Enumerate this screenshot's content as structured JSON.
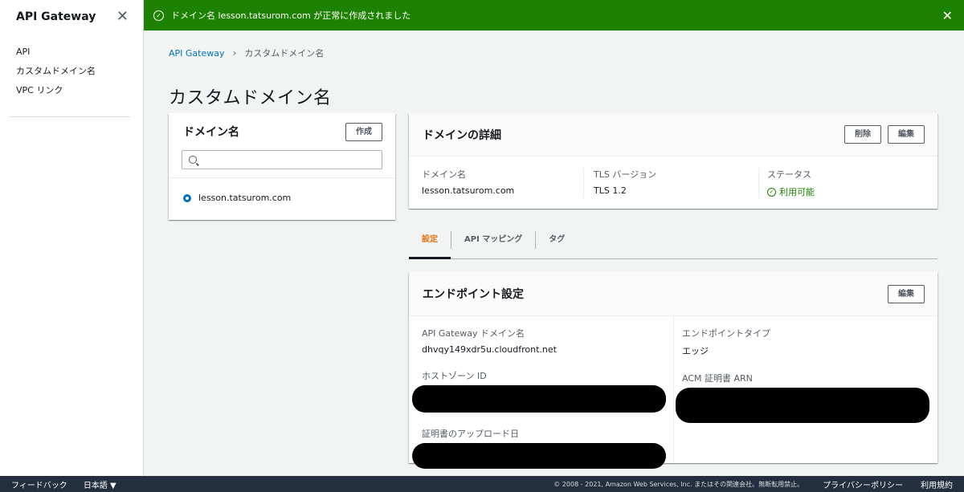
{
  "sidebar": {
    "title": "API Gateway",
    "items": [
      {
        "label": "API"
      },
      {
        "label": "カスタムドメイン名"
      },
      {
        "label": "VPC リンク"
      }
    ]
  },
  "flash": {
    "message": "ドメイン名 lesson.tatsurom.com が正常に作成されました",
    "color": "#1d8102"
  },
  "breadcrumb": {
    "root": "API Gateway",
    "current": "カスタムドメイン名"
  },
  "page_title": "カスタムドメイン名",
  "domain_list": {
    "title": "ドメイン名",
    "create_label": "作成",
    "search_placeholder": "",
    "items": [
      {
        "name": "lesson.tatsurom.com",
        "selected": true
      }
    ]
  },
  "domain_detail": {
    "title": "ドメインの詳細",
    "delete_label": "削除",
    "edit_label": "編集",
    "fields": {
      "domain_label": "ドメイン名",
      "domain_value": "lesson.tatsurom.com",
      "tls_label": "TLS バージョン",
      "tls_value": "TLS 1.2",
      "status_label": "ステータス",
      "status_value": "利用可能"
    }
  },
  "tabs": [
    {
      "label": "設定",
      "active": true
    },
    {
      "label": "API マッピング",
      "active": false
    },
    {
      "label": "タグ",
      "active": false
    }
  ],
  "endpoint": {
    "title": "エンドポイント設定",
    "edit_label": "編集",
    "gateway_domain_label": "API Gateway ドメイン名",
    "gateway_domain_value": "dhvqy149xdr5u.cloudfront.net",
    "endpoint_type_label": "エンドポイントタイプ",
    "endpoint_type_value": "エッジ",
    "hosted_zone_label": "ホストゾーン ID",
    "acm_label": "ACM 証明書 ARN",
    "upload_date_label": "証明書のアップロード日"
  },
  "footer": {
    "feedback": "フィードバック",
    "language": "日本語 ▼",
    "copyright": "© 2008 - 2021, Amazon Web Services, Inc. またはその関連会社。無断転用禁止。",
    "privacy": "プライバシーポリシー",
    "terms": "利用規約"
  }
}
